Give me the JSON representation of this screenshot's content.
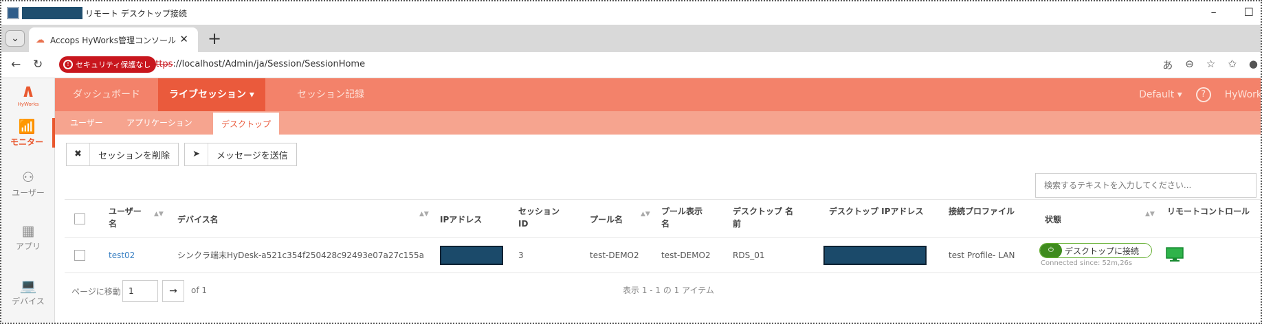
{
  "window": {
    "title": "リモート デスクトップ接続",
    "controls": [
      "–",
      "☐"
    ]
  },
  "browser": {
    "tab_dropdown": "⌄",
    "tab_title": "Accops HyWorks管理コンソール",
    "tab_close": "✕",
    "new_tab": "+",
    "security_badge": "セキュリティ保護なし",
    "url_proto": "https",
    "url_rest": "://localhost/Admin/ja/Session/SessionHome"
  },
  "leftnav": {
    "logo_brand": "HyWorks",
    "items": [
      {
        "label": "モニター"
      },
      {
        "label": "ユーザー"
      },
      {
        "label": "アプリ"
      },
      {
        "label": "デバイス"
      }
    ]
  },
  "topnav": {
    "items": [
      {
        "label": "ダッシュボード"
      },
      {
        "label": "ライブセッション ▾"
      },
      {
        "label": "セッション記録"
      }
    ],
    "profile": "Default ▾",
    "help": "?",
    "user": "HyWork"
  },
  "subnav": {
    "tabs": [
      {
        "label": "ユーザー"
      },
      {
        "label": "アプリケーション"
      },
      {
        "label": "デスクトップ"
      }
    ]
  },
  "toolbar": {
    "delete_label": "セッションを削除",
    "message_label": "メッセージを送信"
  },
  "search": {
    "placeholder": "検索するテキストを入力してください..."
  },
  "table": {
    "columns": [
      "ユーザー名",
      "デバイス名",
      "IPアドレス",
      "セッションID",
      "プール名",
      "プール表示名",
      "デスクトップ 名前",
      "デスクトップ IPアドレス",
      "接続プロファイル",
      "状態",
      "リモートコントロール"
    ],
    "rows": [
      {
        "user": "test02",
        "device": "シンクラ端末HyDesk-a521c354f250428c92493e07a27c155a",
        "session_id": "3",
        "pool": "test-DEMO2",
        "pool_display": "test-DEMO2",
        "desktop_name": "RDS_01",
        "profile": "test Profile- LAN",
        "status": "デスクトップに接続",
        "status_sub": "Connected since: 52m,26s"
      }
    ]
  },
  "pager": {
    "label": "ページに移動",
    "page": "1",
    "go": "→",
    "of": "of 1",
    "count": "表示 1 - 1 の 1 アイテム"
  },
  "colors": {
    "topbar": "#f3826a",
    "topbar_active": "#ea5a3c",
    "subnav": "#f6a48f",
    "status_green": "#3f8b1e",
    "link": "#3a80c3",
    "security_red": "#c8161d"
  }
}
